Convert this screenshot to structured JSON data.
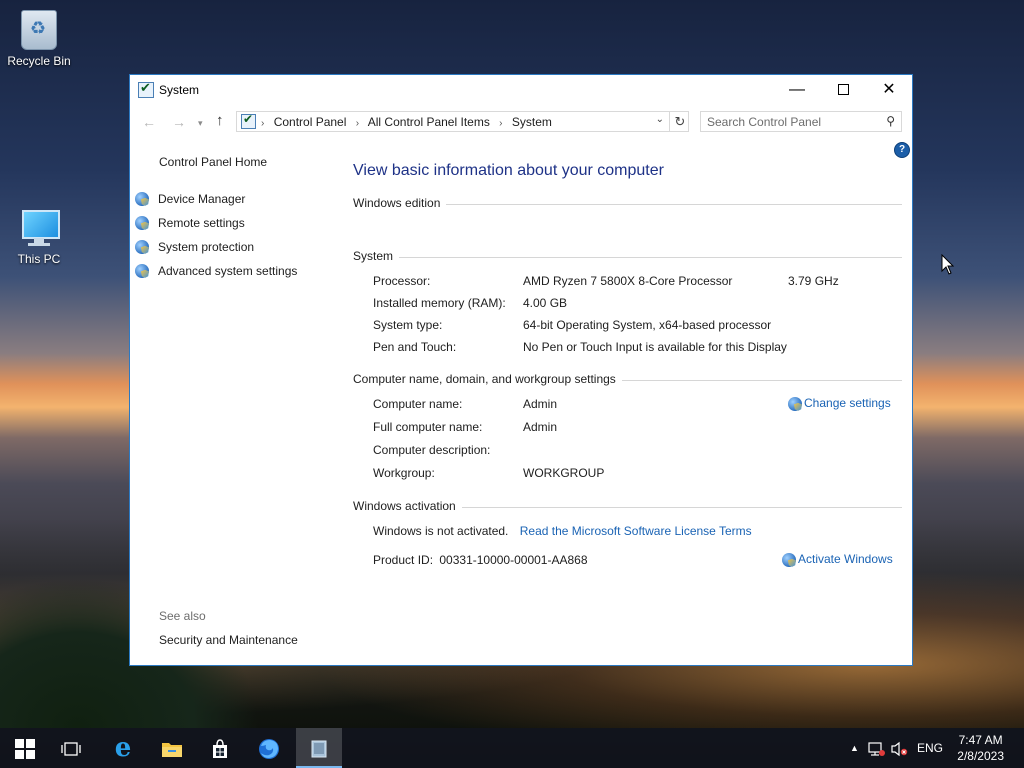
{
  "desktop": {
    "icons": [
      {
        "label": "Recycle Bin",
        "icon": "recycle-bin-icon"
      },
      {
        "label": "This PC",
        "icon": "computer-icon"
      }
    ]
  },
  "window": {
    "title": "System",
    "controls": {
      "minimize": "—",
      "close": "✕"
    },
    "address": {
      "crumbs": [
        "Control Panel",
        "All Control Panel Items",
        "System"
      ],
      "separator": "›"
    },
    "search": {
      "placeholder": "Search Control Panel"
    },
    "help": "?"
  },
  "sidebar": {
    "home": "Control Panel Home",
    "items": [
      {
        "label": "Device Manager"
      },
      {
        "label": "Remote settings"
      },
      {
        "label": "System protection"
      },
      {
        "label": "Advanced system settings"
      }
    ],
    "see_also": "See also",
    "see_also_items": [
      "Security and Maintenance"
    ]
  },
  "main": {
    "heading": "View basic information about your computer",
    "windows_edition": {
      "title": "Windows edition"
    },
    "system": {
      "title": "System",
      "processor_label": "Processor:",
      "processor_value": "AMD Ryzen 7 5800X 8-Core Processor",
      "processor_speed": "3.79 GHz",
      "memory_label": "Installed memory (RAM):",
      "memory_value": "4.00 GB",
      "type_label": "System type:",
      "type_value": "64-bit Operating System, x64-based processor",
      "pen_label": "Pen and Touch:",
      "pen_value": "No Pen or Touch Input is available for this Display"
    },
    "computer": {
      "title": "Computer name, domain, and workgroup settings",
      "name_label": "Computer name:",
      "name_value": "Admin",
      "full_label": "Full computer name:",
      "full_value": "Admin",
      "desc_label": "Computer description:",
      "desc_value": "",
      "workgroup_label": "Workgroup:",
      "workgroup_value": "WORKGROUP",
      "change_settings": "Change settings"
    },
    "activation": {
      "title": "Windows activation",
      "status": "Windows is not activated.",
      "license_link": "Read the Microsoft Software License Terms",
      "product_id_label": "Product ID:",
      "product_id_value": "00331-10000-00001-AA868",
      "activate_link": "Activate Windows"
    }
  },
  "taskbar": {
    "language": "ENG",
    "time": "7:47 AM",
    "date": "2/8/2023"
  }
}
